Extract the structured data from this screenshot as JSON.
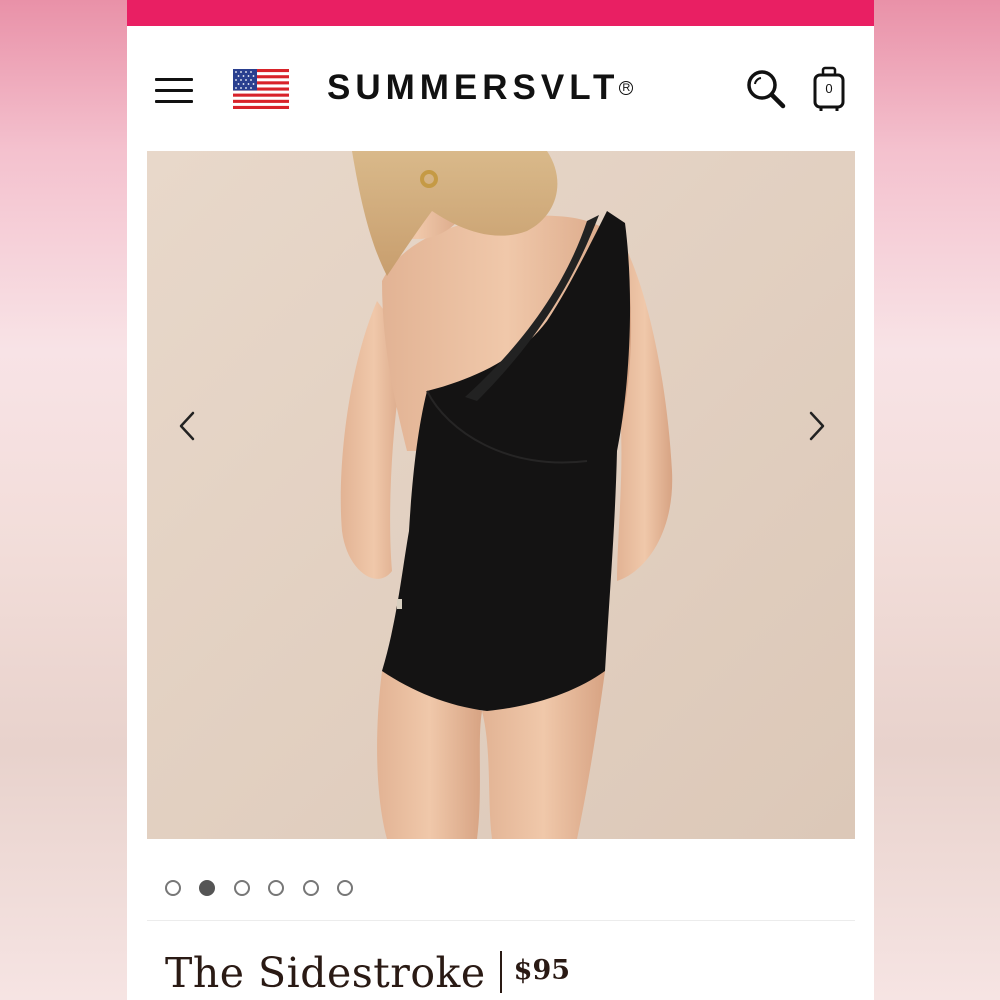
{
  "header": {
    "logo_text": "SUMMERSVLT",
    "logo_mark": "R",
    "cart_count": "0",
    "icons": {
      "menu": "hamburger-menu-icon",
      "flag": "us-flag-icon",
      "search": "search-icon",
      "cart": "shopping-bag-icon"
    }
  },
  "colors": {
    "promo_bar": "#e91f63",
    "text_dark": "#2a1a14",
    "gallery_bg": "#e4d4c6"
  },
  "gallery": {
    "image_description_icon": "product-photo",
    "prev_icon": "chevron-left-icon",
    "next_icon": "chevron-right-icon",
    "slide_count": 6,
    "active_slide": 2
  },
  "product": {
    "title": "The Sidestroke",
    "price": "$95"
  }
}
